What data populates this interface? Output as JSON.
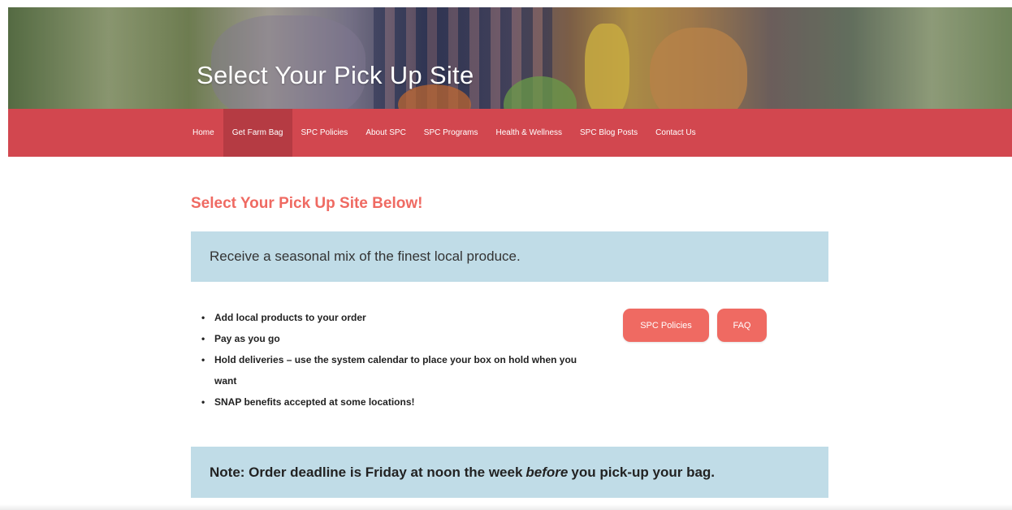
{
  "hero": {
    "title": "Select Your Pick Up Site"
  },
  "nav": {
    "items": [
      {
        "label": "Home",
        "active": false
      },
      {
        "label": "Get Farm Bag",
        "active": true
      },
      {
        "label": "SPC Policies",
        "active": false
      },
      {
        "label": "About SPC",
        "active": false
      },
      {
        "label": "SPC Programs",
        "active": false
      },
      {
        "label": "Health & Wellness",
        "active": false
      },
      {
        "label": "SPC Blog Posts",
        "active": false
      },
      {
        "label": "Contact Us",
        "active": false
      }
    ]
  },
  "main": {
    "heading": "Select Your Pick Up Site Below!",
    "intro": "Receive a seasonal mix of the finest local produce.",
    "features": [
      "Add local products to your order",
      "Pay as you go",
      "Hold deliveries – use the system calendar to place your box on hold when you want",
      "SNAP benefits accepted at some locations!"
    ],
    "buttons": {
      "policies": "SPC Policies",
      "faq": "FAQ"
    },
    "note": {
      "before_em": "Note: Order deadline is Friday at noon the week",
      "em": "before",
      "after_em": "you pick-up your bag."
    }
  },
  "colors": {
    "nav_bg": "#d2474f",
    "nav_active": "#b53b43",
    "accent": "#ef6a62",
    "info_bg": "#c0dce7"
  },
  "icons": {
    "bullet": "•"
  }
}
